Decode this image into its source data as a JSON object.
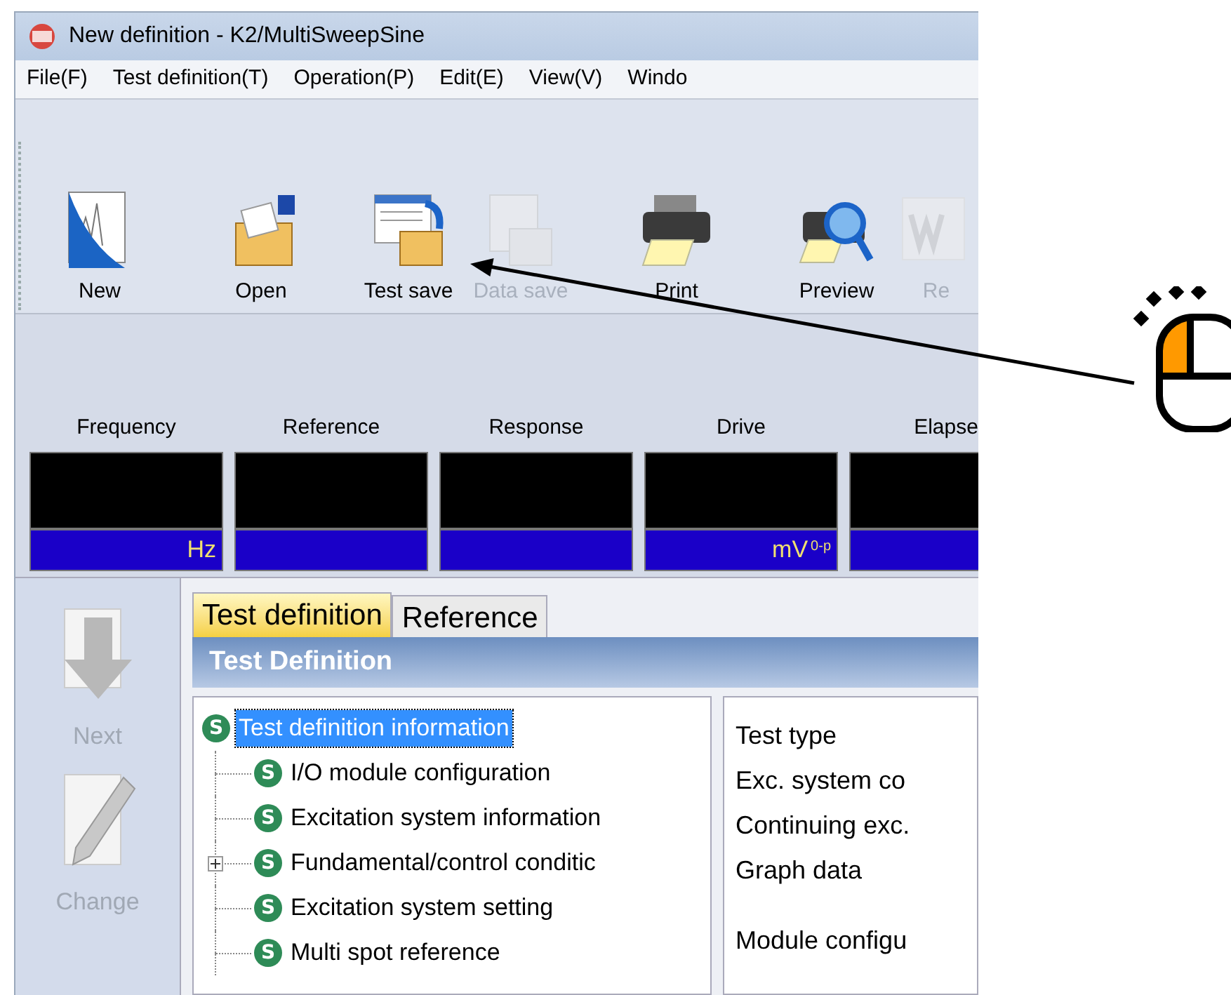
{
  "window": {
    "title": "New definition - K2/MultiSweepSine"
  },
  "menu": [
    {
      "label": "File(F)"
    },
    {
      "label": "Test definition(T)"
    },
    {
      "label": "Operation(P)"
    },
    {
      "label": "Edit(E)"
    },
    {
      "label": "View(V)"
    },
    {
      "label": "Windo"
    }
  ],
  "toolbar": [
    {
      "kind": "new",
      "label": "New",
      "disabled": false
    },
    {
      "kind": "open",
      "label": "Open",
      "disabled": false
    },
    {
      "kind": "test_save",
      "label": "Test save",
      "disabled": false
    },
    {
      "kind": "data_save",
      "label": "Data save",
      "disabled": true
    },
    {
      "kind": "print",
      "label": "Print",
      "disabled": false
    },
    {
      "kind": "preview",
      "label": "Preview",
      "disabled": false
    },
    {
      "kind": "report",
      "label": "Re",
      "disabled": true
    }
  ],
  "meters": [
    {
      "label": "Frequency",
      "unit": "Hz"
    },
    {
      "label": "Reference"
    },
    {
      "label": "Response"
    },
    {
      "label": "Drive",
      "unit": "mV",
      "unit_suffix": "0-p"
    },
    {
      "label": "Elapse"
    }
  ],
  "sidebar": [
    {
      "kind": "next",
      "label": "Next",
      "disabled": true
    },
    {
      "kind": "change",
      "label": "Change",
      "disabled": true
    }
  ],
  "tabs": [
    {
      "label": "Test definition",
      "selected": true
    },
    {
      "label": "Reference",
      "selected": false
    }
  ],
  "panel": {
    "title": "Test Definition"
  },
  "tree": [
    {
      "badge": "S",
      "label": "Test definition information",
      "selected": true,
      "children": [
        {
          "badge": "S",
          "label": "I/O module configuration",
          "selected": false,
          "collapsed": false
        },
        {
          "badge": "S",
          "label": "Excitation system information",
          "selected": false,
          "collapsed": false
        },
        {
          "badge": "S",
          "label": "Fundamental/control conditic",
          "selected": false,
          "collapsed": true
        },
        {
          "badge": "S",
          "label": "Excitation system setting",
          "selected": false,
          "collapsed": false
        },
        {
          "badge": "S",
          "label": "Multi spot reference",
          "selected": false,
          "collapsed": false
        }
      ]
    }
  ],
  "details": [
    "Test type",
    "Exc. system co",
    "Continuing exc.",
    "Graph data",
    "Module configu"
  ]
}
